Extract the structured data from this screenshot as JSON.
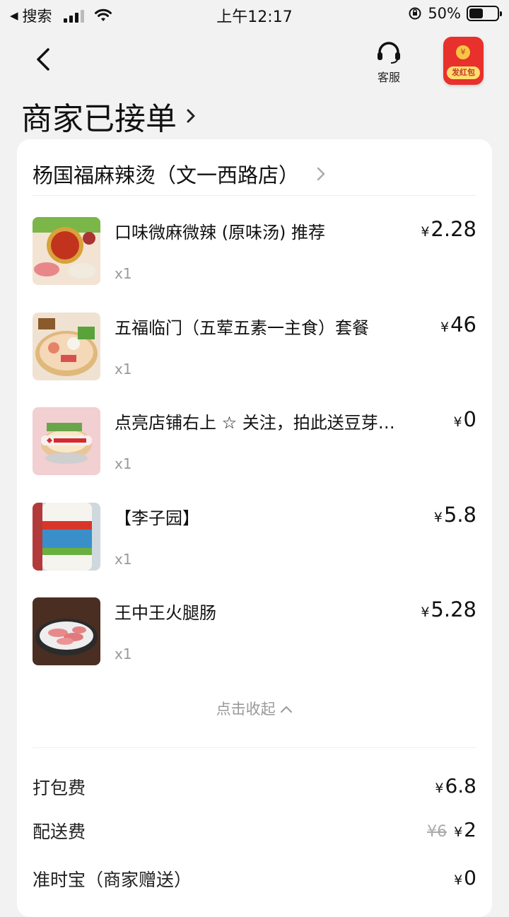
{
  "status_bar": {
    "back_app": "搜索",
    "time": "上午12:17",
    "battery": "50%",
    "battery_level": 0.5
  },
  "nav": {
    "customer_service": "客服",
    "red_packet": "发红包",
    "red_packet_coin": "¥"
  },
  "order_status": "商家已接单",
  "shop": {
    "name": "杨国福麻辣烫（文一西路店）"
  },
  "items": [
    {
      "name": "口味微麻微辣 (原味汤) 推荐",
      "qty": "x1",
      "currency": "¥",
      "price": "2.28"
    },
    {
      "name": "五福临门（五荤五素一主食）套餐",
      "qty": "x1",
      "currency": "¥",
      "price": "46"
    },
    {
      "name": "点亮店铺右上 ☆ 关注，拍此送豆芽…",
      "qty": "x1",
      "currency": "¥",
      "price": "0"
    },
    {
      "name": "【李子园】",
      "qty": "x1",
      "currency": "¥",
      "price": "5.8"
    },
    {
      "name": "王中王火腿肠",
      "qty": "x1",
      "currency": "¥",
      "price": "5.28"
    }
  ],
  "collapse_label": "点击收起",
  "fees": [
    {
      "label": "打包费",
      "currency": "¥",
      "value": "6.8"
    },
    {
      "label": "配送费",
      "original": "¥6",
      "currency": "¥",
      "value": "2"
    },
    {
      "label": "准时宝（商家赠送）",
      "currency": "¥",
      "value": "0"
    }
  ]
}
